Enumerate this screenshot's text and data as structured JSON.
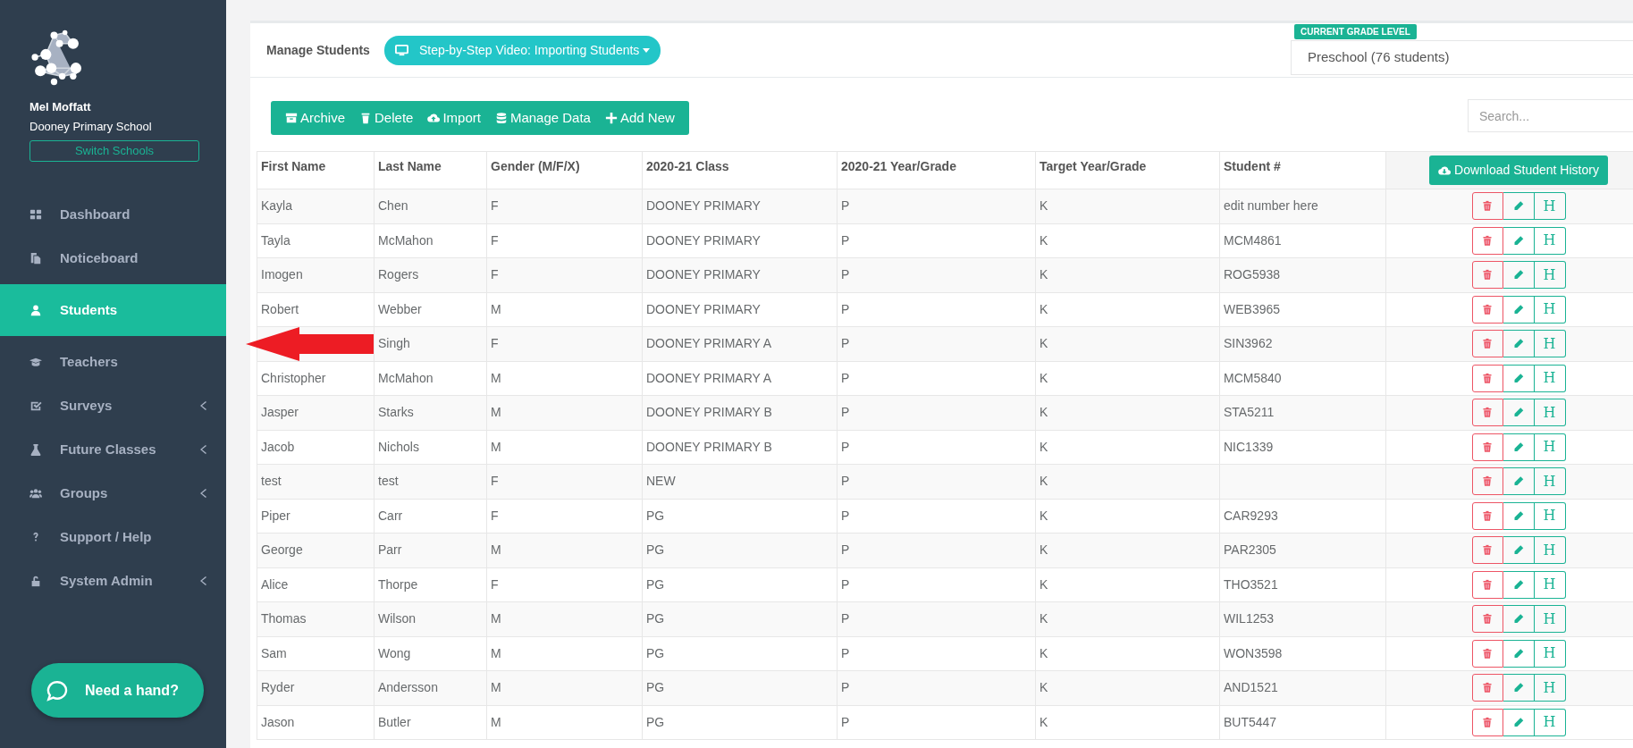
{
  "sidebar": {
    "user_name": "Mel Moffatt",
    "school": "Dooney Primary School",
    "switch_button": "Switch Schools",
    "items": [
      {
        "label": "Dashboard",
        "selected": false,
        "expandable": false
      },
      {
        "label": "Noticeboard",
        "selected": false,
        "expandable": false
      },
      {
        "label": "Students",
        "selected": true,
        "expandable": false
      },
      {
        "label": "Teachers",
        "selected": false,
        "expandable": false
      },
      {
        "label": "Surveys",
        "selected": false,
        "expandable": true
      },
      {
        "label": "Future Classes",
        "selected": false,
        "expandable": true
      },
      {
        "label": "Groups",
        "selected": false,
        "expandable": true
      },
      {
        "label": "Support / Help",
        "selected": false,
        "expandable": false
      },
      {
        "label": "System Admin",
        "selected": false,
        "expandable": true
      }
    ]
  },
  "help_widget": {
    "label": "Need a hand?"
  },
  "header": {
    "title": "Manage Students",
    "video_button": "Step-by-Step Video: Importing Students",
    "grade_label": "CURRENT GRADE LEVEL",
    "grade_value": "Preschool (76 students)"
  },
  "toolbar": {
    "buttons": [
      "Archive",
      "Delete",
      "Import",
      "Manage Data",
      "Add New"
    ],
    "search": {
      "placeholder": "Search..."
    }
  },
  "table": {
    "columns": [
      "First Name",
      "Last Name",
      "Gender (M/F/X)",
      "2020-21 Class",
      "2020-21 Year/Grade",
      "Target Year/Grade",
      "Student #"
    ],
    "download_button": "Download Student History",
    "rows": [
      {
        "cells": [
          "Kayla",
          "Chen",
          "F",
          "DOONEY PRIMARY",
          "P",
          "K",
          "edit number here"
        ],
        "history_button": "H"
      },
      {
        "cells": [
          "Tayla",
          "McMahon",
          "F",
          "DOONEY PRIMARY",
          "P",
          "K",
          "MCM4861"
        ],
        "history_button": "H"
      },
      {
        "cells": [
          "Imogen",
          "Rogers",
          "F",
          "DOONEY PRIMARY",
          "P",
          "K",
          "ROG5938"
        ],
        "history_button": "H"
      },
      {
        "cells": [
          "Robert",
          "Webber",
          "M",
          "DOONEY PRIMARY",
          "P",
          "K",
          "WEB3965"
        ],
        "history_button": "H"
      },
      {
        "cells": [
          null,
          "Singh",
          "F",
          "DOONEY PRIMARY A",
          "P",
          "K",
          "SIN3962"
        ],
        "history_button": "H"
      },
      {
        "cells": [
          "Christopher",
          "McMahon",
          "M",
          "DOONEY PRIMARY A",
          "P",
          "K",
          "MCM5840"
        ],
        "history_button": "H"
      },
      {
        "cells": [
          "Jasper",
          "Starks",
          "M",
          "DOONEY PRIMARY B",
          "P",
          "K",
          "STA5211"
        ],
        "history_button": "H"
      },
      {
        "cells": [
          "Jacob",
          "Nichols",
          "M",
          "DOONEY PRIMARY B",
          "P",
          "K",
          "NIC1339"
        ],
        "history_button": "H"
      },
      {
        "cells": [
          "test",
          "test",
          "F",
          "NEW",
          "P",
          "K"
        ],
        "history_button": "H"
      },
      {
        "cells": [
          "Piper",
          "Carr",
          "F",
          "PG",
          "P",
          "K",
          "CAR9293"
        ],
        "history_button": "H"
      },
      {
        "cells": [
          "George",
          "Parr",
          "M",
          "PG",
          "P",
          "K",
          "PAR2305"
        ],
        "history_button": "H"
      },
      {
        "cells": [
          "Alice",
          "Thorpe",
          "F",
          "PG",
          "P",
          "K",
          "THO3521"
        ],
        "history_button": "H"
      },
      {
        "cells": [
          "Thomas",
          "Wilson",
          "M",
          "PG",
          "P",
          "K",
          "WIL1253"
        ],
        "history_button": "H"
      },
      {
        "cells": [
          "Sam",
          "Wong",
          "M",
          "PG",
          "P",
          "K",
          "WON3598"
        ],
        "history_button": "H"
      },
      {
        "cells": [
          "Ryder",
          "Andersson",
          "M",
          "PG",
          "P",
          "K",
          "AND1521"
        ],
        "history_button": "H"
      },
      {
        "cells": [
          "Jason",
          "Butler",
          "M",
          "PG",
          "P",
          "K",
          "BUT5447"
        ],
        "history_button": "H"
      }
    ]
  }
}
